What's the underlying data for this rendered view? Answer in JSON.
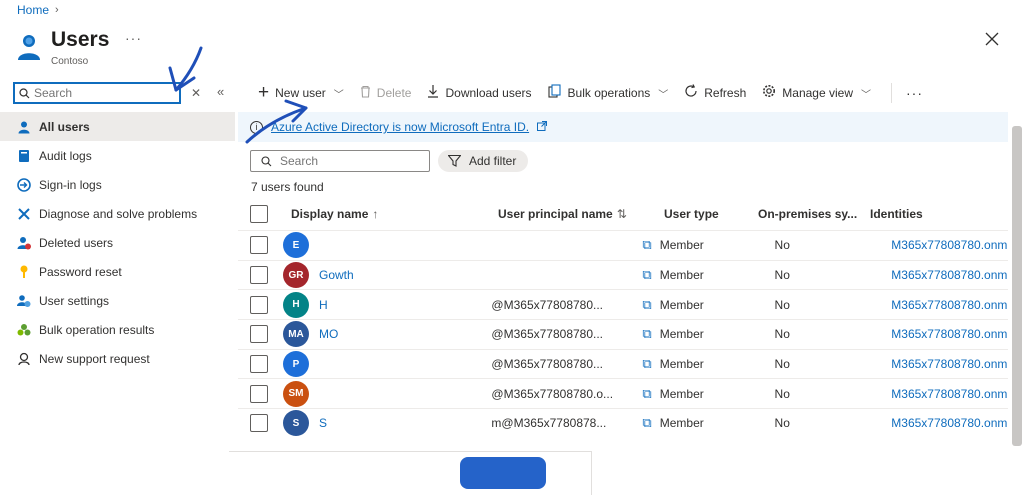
{
  "breadcrumb": {
    "home": "Home"
  },
  "header": {
    "title": "Users",
    "subtitle": "Contoso",
    "more": "···"
  },
  "sidebar": {
    "search_placeholder": "Search",
    "items": [
      {
        "label": "All users",
        "icon": "user-icon",
        "active": true
      },
      {
        "label": "Audit logs",
        "icon": "book-icon"
      },
      {
        "label": "Sign-in logs",
        "icon": "signin-icon"
      },
      {
        "label": "Diagnose and solve problems",
        "icon": "wrench-icon"
      },
      {
        "label": "Deleted users",
        "icon": "deleted-user-icon"
      },
      {
        "label": "Password reset",
        "icon": "key-icon"
      },
      {
        "label": "User settings",
        "icon": "settings-users-icon"
      },
      {
        "label": "Bulk operation results",
        "icon": "group-icon"
      },
      {
        "label": "New support request",
        "icon": "support-icon"
      }
    ]
  },
  "toolbar": {
    "new_user": "New user",
    "delete": "Delete",
    "download_users": "Download users",
    "bulk_operations": "Bulk operations",
    "refresh": "Refresh",
    "manage_view": "Manage view",
    "more": "···"
  },
  "banner": {
    "text": "Azure Active Directory is now Microsoft Entra ID."
  },
  "list": {
    "search_placeholder": "Search",
    "add_filter": "Add filter",
    "count_text": "7 users found",
    "columns": {
      "display_name": "Display name",
      "upn": "User principal name",
      "user_type": "User type",
      "on_premises": "On-premises sy...",
      "identities": "Identities"
    },
    "rows": [
      {
        "initials": "E",
        "color": "#1e6fd9",
        "name": "",
        "upn": "",
        "type": "Member",
        "onprem": "No",
        "identity": "M365x77808780.onm"
      },
      {
        "initials": "GR",
        "color": "#a4262c",
        "name": "Gowth",
        "upn": "",
        "type": "Member",
        "onprem": "No",
        "identity": "M365x77808780.onm"
      },
      {
        "initials": "H",
        "color": "#038387",
        "name": "H",
        "upn": "@M365x77808780...",
        "type": "Member",
        "onprem": "No",
        "identity": "M365x77808780.onm"
      },
      {
        "initials": "MA",
        "color": "#2b579a",
        "name": "MO",
        "upn": "@M365x77808780...",
        "type": "Member",
        "onprem": "No",
        "identity": "M365x77808780.onm"
      },
      {
        "initials": "P",
        "color": "#1e6fd9",
        "name": "",
        "upn": "@M365x77808780...",
        "type": "Member",
        "onprem": "No",
        "identity": "M365x77808780.onm"
      },
      {
        "initials": "SM",
        "color": "#ca5010",
        "name": "",
        "upn": "@M365x77808780.o...",
        "type": "Member",
        "onprem": "No",
        "identity": "M365x77808780.onm"
      },
      {
        "initials": "S",
        "color": "#2b579a",
        "name": "S",
        "upn": "m@M365x7780878...",
        "type": "Member",
        "onprem": "No",
        "identity": "M365x77808780.onm"
      }
    ]
  }
}
